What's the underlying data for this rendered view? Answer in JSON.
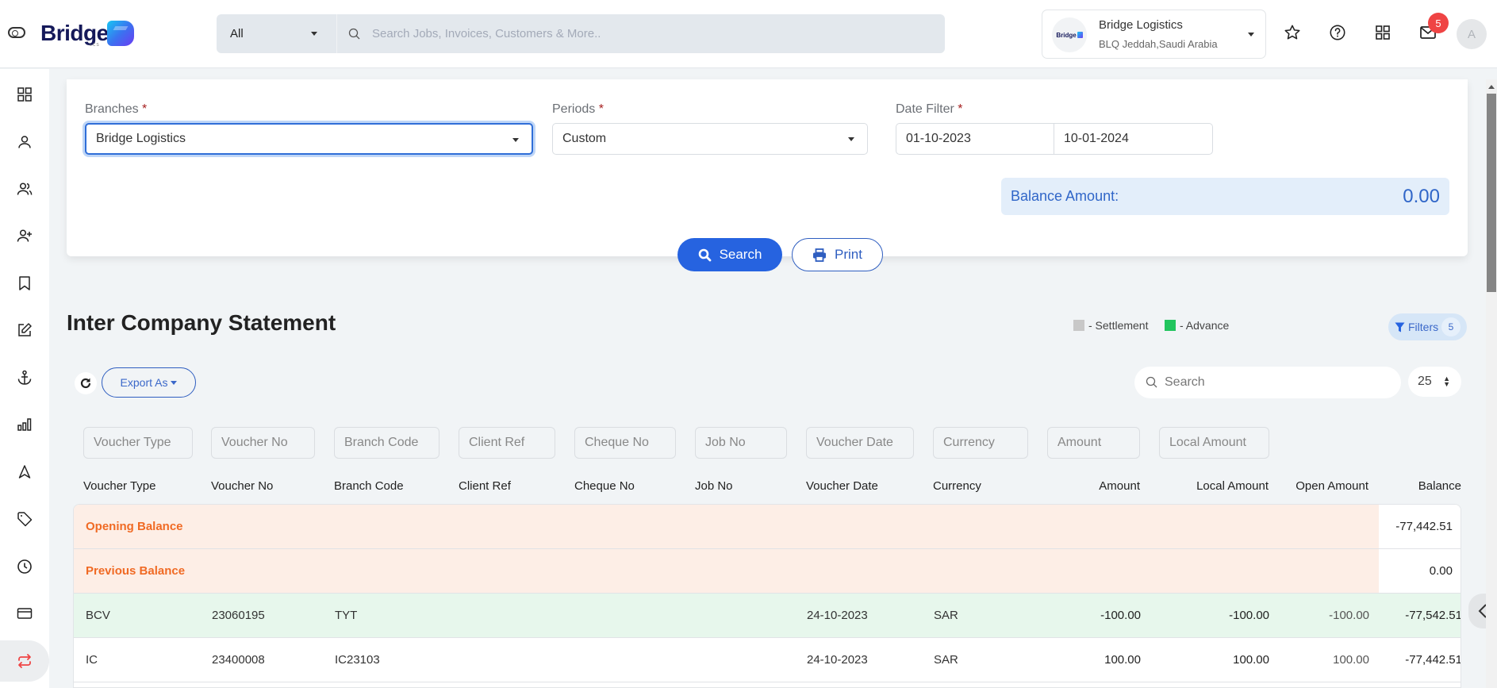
{
  "header": {
    "logo_text": "Bridge",
    "logo_sub": "LCS",
    "search_scope": "All",
    "search_placeholder": "Search Jobs, Invoices, Customers & More..",
    "company": {
      "avatar_text": "Bridge",
      "name": "Bridge Logistics",
      "location": "BLQ Jeddah,Saudi Arabia"
    },
    "icons": [
      "star-icon",
      "help-icon",
      "apps-grid-icon",
      "mail-icon"
    ],
    "notification_count": "5",
    "user_initial": "A"
  },
  "sidebar": {
    "items": [
      {
        "name": "dashboard",
        "icon": "grid-icon"
      },
      {
        "name": "user",
        "icon": "user-icon"
      },
      {
        "name": "users",
        "icon": "users-icon"
      },
      {
        "name": "add-user",
        "icon": "user-plus-icon"
      },
      {
        "name": "bookmark",
        "icon": "bookmark-icon"
      },
      {
        "name": "edit",
        "icon": "edit-icon"
      },
      {
        "name": "anchor",
        "icon": "anchor-icon"
      },
      {
        "name": "reports",
        "icon": "bar-chart-icon"
      },
      {
        "name": "navigation",
        "icon": "navigation-icon"
      },
      {
        "name": "tag",
        "icon": "tag-icon"
      },
      {
        "name": "history",
        "icon": "clock-icon"
      },
      {
        "name": "payments",
        "icon": "credit-card-icon"
      },
      {
        "name": "inter-company",
        "icon": "repeat-icon",
        "active": true
      }
    ],
    "active_color": "#ef4444"
  },
  "filters": {
    "branches_label": "Branches",
    "branches_value": "Bridge Logistics",
    "periods_label": "Periods",
    "periods_value": "Custom",
    "date_filter_label": "Date Filter",
    "date_from": "01-10-2023",
    "date_to": "10-01-2024",
    "required_mark": "*",
    "balance_label": "Balance Amount:",
    "balance_value": "0.00",
    "search_button": "Search",
    "print_button": "Print"
  },
  "statement": {
    "title": "Inter Company Statement",
    "legend": [
      {
        "label": "- Settlement",
        "color": "#c8c8c8"
      },
      {
        "label": "- Advance",
        "color": "#22c55e"
      }
    ],
    "filters_button": "Filters",
    "filters_count": "5",
    "export_button": "Export As",
    "search_placeholder": "Search",
    "page_size": "25",
    "column_filters": [
      "Voucher Type",
      "Voucher No",
      "Branch Code",
      "Client Ref",
      "Cheque No",
      "Job No",
      "Voucher Date",
      "Currency",
      "Amount",
      "Local Amount"
    ],
    "columns": [
      "Voucher Type",
      "Voucher No",
      "Branch Code",
      "Client Ref",
      "Cheque No",
      "Job No",
      "Voucher Date",
      "Currency",
      "Amount",
      "Local Amount",
      "Open Amount",
      "Balance"
    ],
    "balance_rows": [
      {
        "label": "Opening Balance",
        "balance": "-77,442.51"
      },
      {
        "label": "Previous Balance",
        "balance": "0.00"
      }
    ],
    "rows": [
      {
        "voucher_type": "BCV",
        "voucher_no": "23060195",
        "branch_code": "TYT",
        "client_ref": "",
        "cheque_no": "",
        "job_no": "",
        "voucher_date": "24-10-2023",
        "currency": "SAR",
        "amount": "-100.00",
        "local_amount": "-100.00",
        "open_amount": "-100.00",
        "balance": "-77,542.51",
        "kind": "advance"
      },
      {
        "voucher_type": "IC",
        "voucher_no": "23400008",
        "branch_code": "IC23103",
        "client_ref": "",
        "cheque_no": "",
        "job_no": "",
        "voucher_date": "24-10-2023",
        "currency": "SAR",
        "amount": "100.00",
        "local_amount": "100.00",
        "open_amount": "100.00",
        "balance": "-77,442.51",
        "kind": "plain"
      }
    ]
  }
}
